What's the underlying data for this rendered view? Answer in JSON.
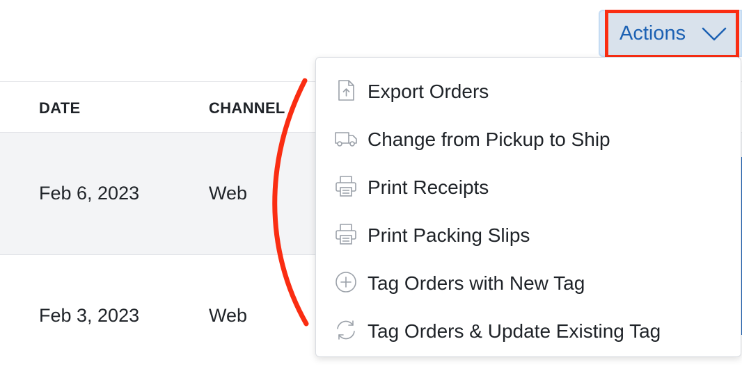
{
  "table": {
    "columns": [
      "DATE",
      "CHANNEL"
    ],
    "rows": [
      {
        "date": "Feb 6, 2023",
        "channel": "Web"
      },
      {
        "date": "Feb 3, 2023",
        "channel": "Web"
      }
    ]
  },
  "actions": {
    "label": "Actions",
    "icon": "chevron-down-icon"
  },
  "menu": {
    "items": [
      {
        "label": "Export Orders",
        "icon": "file-upload-icon"
      },
      {
        "label": "Change from Pickup to Ship",
        "icon": "truck-icon"
      },
      {
        "label": "Print Receipts",
        "icon": "printer-icon"
      },
      {
        "label": "Print Packing Slips",
        "icon": "printer-icon"
      },
      {
        "label": "Tag Orders with New Tag",
        "icon": "plus-circle-icon"
      },
      {
        "label": "Tag Orders & Update Existing Tag",
        "icon": "refresh-icon"
      }
    ]
  },
  "colors": {
    "accent": "#1c61b3",
    "highlight": "#fa2d12",
    "row_alt": "#f3f4f6"
  }
}
